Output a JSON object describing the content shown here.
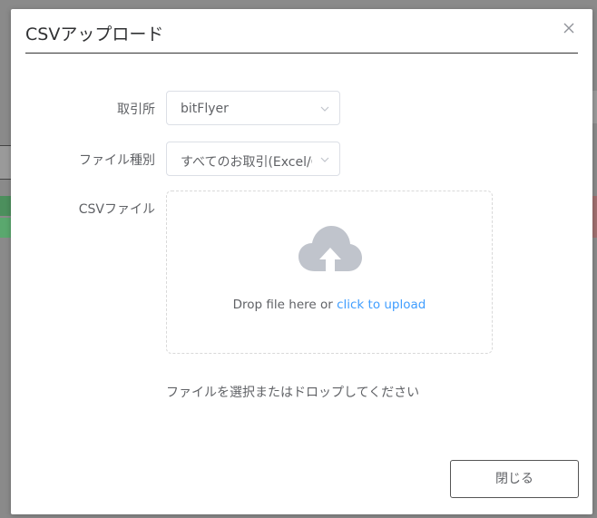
{
  "dialog": {
    "title": "CSVアップロード",
    "close_button_label": "閉じる"
  },
  "form": {
    "exchange": {
      "label": "取引所",
      "value": "bitFlyer"
    },
    "file_type": {
      "label": "ファイル種別",
      "value": "すべてのお取引(Excel/CSV)"
    },
    "csv_file": {
      "label": "CSVファイル",
      "drop_text": "Drop file here or ",
      "upload_link": "click to upload",
      "hint": "ファイルを選択またはドロップしてください"
    }
  },
  "icons": {
    "close": "close-icon",
    "dropdown": "chevron-down-icon",
    "upload": "cloud-upload-icon"
  },
  "colors": {
    "link": "#409eff",
    "text": "#606266",
    "title": "#303133",
    "icon": "#c0c4cc",
    "overlay": "#8a8a8a"
  }
}
